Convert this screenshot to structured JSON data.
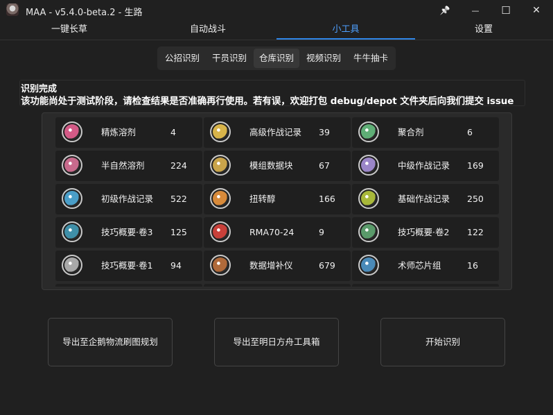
{
  "window": {
    "title": "MAA - v5.4.0-beta.2 - 生路",
    "pin_glyph": "📌",
    "minimize_glyph": "—",
    "maximize_glyph": "☐",
    "close_glyph": "✕"
  },
  "nav": {
    "tabs": [
      {
        "label": "一键长草"
      },
      {
        "label": "自动战斗"
      },
      {
        "label": "小工具"
      },
      {
        "label": "设置"
      }
    ],
    "active": "小工具",
    "accent_color": "#2f86e8"
  },
  "subtabs": {
    "items": [
      {
        "label": "公招识别"
      },
      {
        "label": "干员识别"
      },
      {
        "label": "仓库识别"
      },
      {
        "label": "视频识别"
      },
      {
        "label": "牛牛抽卡"
      }
    ],
    "active": "仓库识别"
  },
  "status": {
    "title": "识别完成",
    "message": "该功能尚处于测试阶段，请检查结果是否准确再行使用。若有误，欢迎打包 debug/depot 文件夹后向我们提交 issue"
  },
  "inventory": {
    "items": [
      {
        "name": "精炼溶剂",
        "count": "4",
        "icon": "refined-solvent-icon",
        "color": "#d35a86"
      },
      {
        "name": "高级作战记录",
        "count": "39",
        "icon": "advanced-battle-record-icon",
        "color": "#d8b44a"
      },
      {
        "name": "聚合剂",
        "count": "6",
        "icon": "polymerization-preparation-icon",
        "color": "#5fae76"
      },
      {
        "name": "半自然溶剂",
        "count": "224",
        "icon": "semi-natural-solvent-icon",
        "color": "#c86a8c"
      },
      {
        "name": "模组数据块",
        "count": "67",
        "icon": "module-data-block-icon",
        "color": "#c9a44a"
      },
      {
        "name": "中级作战记录",
        "count": "169",
        "icon": "intermediate-battle-record-icon",
        "color": "#9b86c8"
      },
      {
        "name": "初级作战记录",
        "count": "522",
        "icon": "basic-battle-record-icon",
        "color": "#4a9ec8"
      },
      {
        "name": "扭转醇",
        "count": "166",
        "icon": "twisted-alcohol-icon",
        "color": "#d88a3a"
      },
      {
        "name": "基础作战记录",
        "count": "250",
        "icon": "drill-battle-record-icon",
        "color": "#a8b83a"
      },
      {
        "name": "技巧概要·卷3",
        "count": "125",
        "icon": "skill-summary-3-icon",
        "color": "#3f8fa8"
      },
      {
        "name": "RMA70-24",
        "count": "9",
        "icon": "rma70-24-icon",
        "color": "#c8403a"
      },
      {
        "name": "技巧概要·卷2",
        "count": "122",
        "icon": "skill-summary-2-icon",
        "color": "#5a9a6a"
      },
      {
        "name": "技巧概要·卷1",
        "count": "94",
        "icon": "skill-summary-1-icon",
        "color": "#a8a8a8"
      },
      {
        "name": "数据增补仪",
        "count": "679",
        "icon": "data-supplement-instrument-icon",
        "color": "#b06a3a"
      },
      {
        "name": "术师芯片组",
        "count": "16",
        "icon": "caster-chip-pack-icon",
        "color": "#4a8ab8"
      }
    ]
  },
  "actions": {
    "export_penguin": "导出至企鹅物流刷图规划",
    "export_toolbox": "导出至明日方舟工具箱",
    "start": "开始识别"
  }
}
